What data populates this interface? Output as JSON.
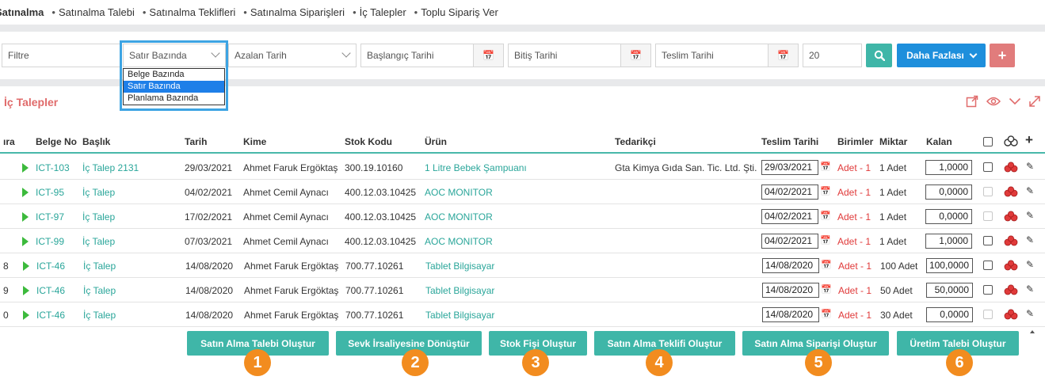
{
  "breadcrumb": [
    "Satınalma",
    "Satınalma Talebi",
    "Satınalma Teklifleri",
    "Satınalma Siparişleri",
    "İç Talepler",
    "Toplu Sipariş Ver"
  ],
  "filters": {
    "filter_placeholder": "Filtre",
    "view_mode": "Satır Bazında",
    "view_options": [
      "Belge Bazında",
      "Satır Bazında",
      "Planlama Bazında"
    ],
    "sort": "Azalan Tarih",
    "start_date_placeholder": "Başlangıç Tarihi",
    "end_date_placeholder": "Bitiş Tarihi",
    "delivery_date_placeholder": "Teslim Tarihi",
    "page_size": "20",
    "more_label": "Daha Fazlası",
    "add_label": "+"
  },
  "panel": {
    "title": "İç Talepler"
  },
  "table": {
    "headers": {
      "sira": "ıra",
      "belge_no": "Belge No",
      "baslik": "Başlık",
      "tarih": "Tarih",
      "kime": "Kime",
      "stok_kodu": "Stok Kodu",
      "urun": "Ürün",
      "tedarikci": "Tedarikçi",
      "teslim_tarihi": "Teslim Tarihi",
      "birimler": "Birimler",
      "miktar": "Miktar",
      "kalan": "Kalan"
    },
    "rows": [
      {
        "sira": "",
        "belge_no": "ICT-103",
        "baslik": "İç Talep 2131",
        "tarih": "29/03/2021",
        "kime": "Ahmet Faruk Ergöktaş",
        "stok_kodu": "300.19.10160",
        "urun": "1 Litre Bebek Şampuanı",
        "tedarikci": "Gta Kimya Gıda San. Tic. Ltd. Şti.",
        "teslim": "29/03/2021",
        "birim": "Adet - 1",
        "miktar": "1 Adet",
        "kalan": "1,0000",
        "cb_enabled": true
      },
      {
        "sira": "",
        "belge_no": "ICT-95",
        "baslik": "İç Talep",
        "tarih": "04/02/2021",
        "kime": "Ahmet Cemil Aynacı",
        "stok_kodu": "400.12.03.10425",
        "urun": "AOC MONITOR",
        "tedarikci": "",
        "teslim": "04/02/2021",
        "birim": "Adet - 1",
        "miktar": "1 Adet",
        "kalan": "0,0000",
        "cb_enabled": false
      },
      {
        "sira": "",
        "belge_no": "ICT-97",
        "baslik": "İç Talep",
        "tarih": "17/02/2021",
        "kime": "Ahmet Cemil Aynacı",
        "stok_kodu": "400.12.03.10425",
        "urun": "AOC MONITOR",
        "tedarikci": "",
        "teslim": "04/02/2021",
        "birim": "Adet - 1",
        "miktar": "1 Adet",
        "kalan": "0,0000",
        "cb_enabled": false
      },
      {
        "sira": "",
        "belge_no": "ICT-99",
        "baslik": "İç Talep",
        "tarih": "07/03/2021",
        "kime": "Ahmet Cemil Aynacı",
        "stok_kodu": "400.12.03.10425",
        "urun": "AOC MONITOR",
        "tedarikci": "",
        "teslim": "04/02/2021",
        "birim": "Adet - 1",
        "miktar": "1 Adet",
        "kalan": "1,0000",
        "cb_enabled": true
      },
      {
        "sira": "8",
        "belge_no": "ICT-46",
        "baslik": "İç Talep",
        "tarih": "14/08/2020",
        "kime": "Ahmet Faruk Ergöktaş",
        "stok_kodu": "700.77.10261",
        "urun": "Tablet Bilgisayar",
        "tedarikci": "",
        "teslim": "14/08/2020",
        "birim": "Adet - 1",
        "miktar": "100 Adet",
        "kalan": "100,0000",
        "cb_enabled": true
      },
      {
        "sira": "9",
        "belge_no": "ICT-46",
        "baslik": "İç Talep",
        "tarih": "14/08/2020",
        "kime": "Ahmet Faruk Ergöktaş",
        "stok_kodu": "700.77.10261",
        "urun": "Tablet Bilgisayar",
        "tedarikci": "",
        "teslim": "14/08/2020",
        "birim": "Adet - 1",
        "miktar": "50 Adet",
        "kalan": "50,0000",
        "cb_enabled": true
      },
      {
        "sira": "0",
        "belge_no": "ICT-46",
        "baslik": "İç Talep",
        "tarih": "14/08/2020",
        "kime": "Ahmet Faruk Ergöktaş",
        "stok_kodu": "700.77.10261",
        "urun": "Tablet Bilgisayar",
        "tedarikci": "",
        "teslim": "14/08/2020",
        "birim": "Adet - 1",
        "miktar": "30 Adet",
        "kalan": "0,0000",
        "cb_enabled": false
      }
    ]
  },
  "actions": [
    {
      "label": "Satın Alma Talebi Oluştur",
      "num": "1"
    },
    {
      "label": "Sevk İrsaliyesine Dönüştür",
      "num": "2"
    },
    {
      "label": "Stok Fişi Oluştur",
      "num": "3"
    },
    {
      "label": "Satın Alma Teklifi Oluştur",
      "num": "4"
    },
    {
      "label": "Satın Alma Siparişi Oluştur",
      "num": "5"
    },
    {
      "label": "Üretim Talebi Oluştur",
      "num": "6"
    }
  ],
  "colors": {
    "accent": "#3fb6a8",
    "primary": "#1e8fdc",
    "danger": "#e17c7c",
    "badge": "#f28c1f"
  }
}
